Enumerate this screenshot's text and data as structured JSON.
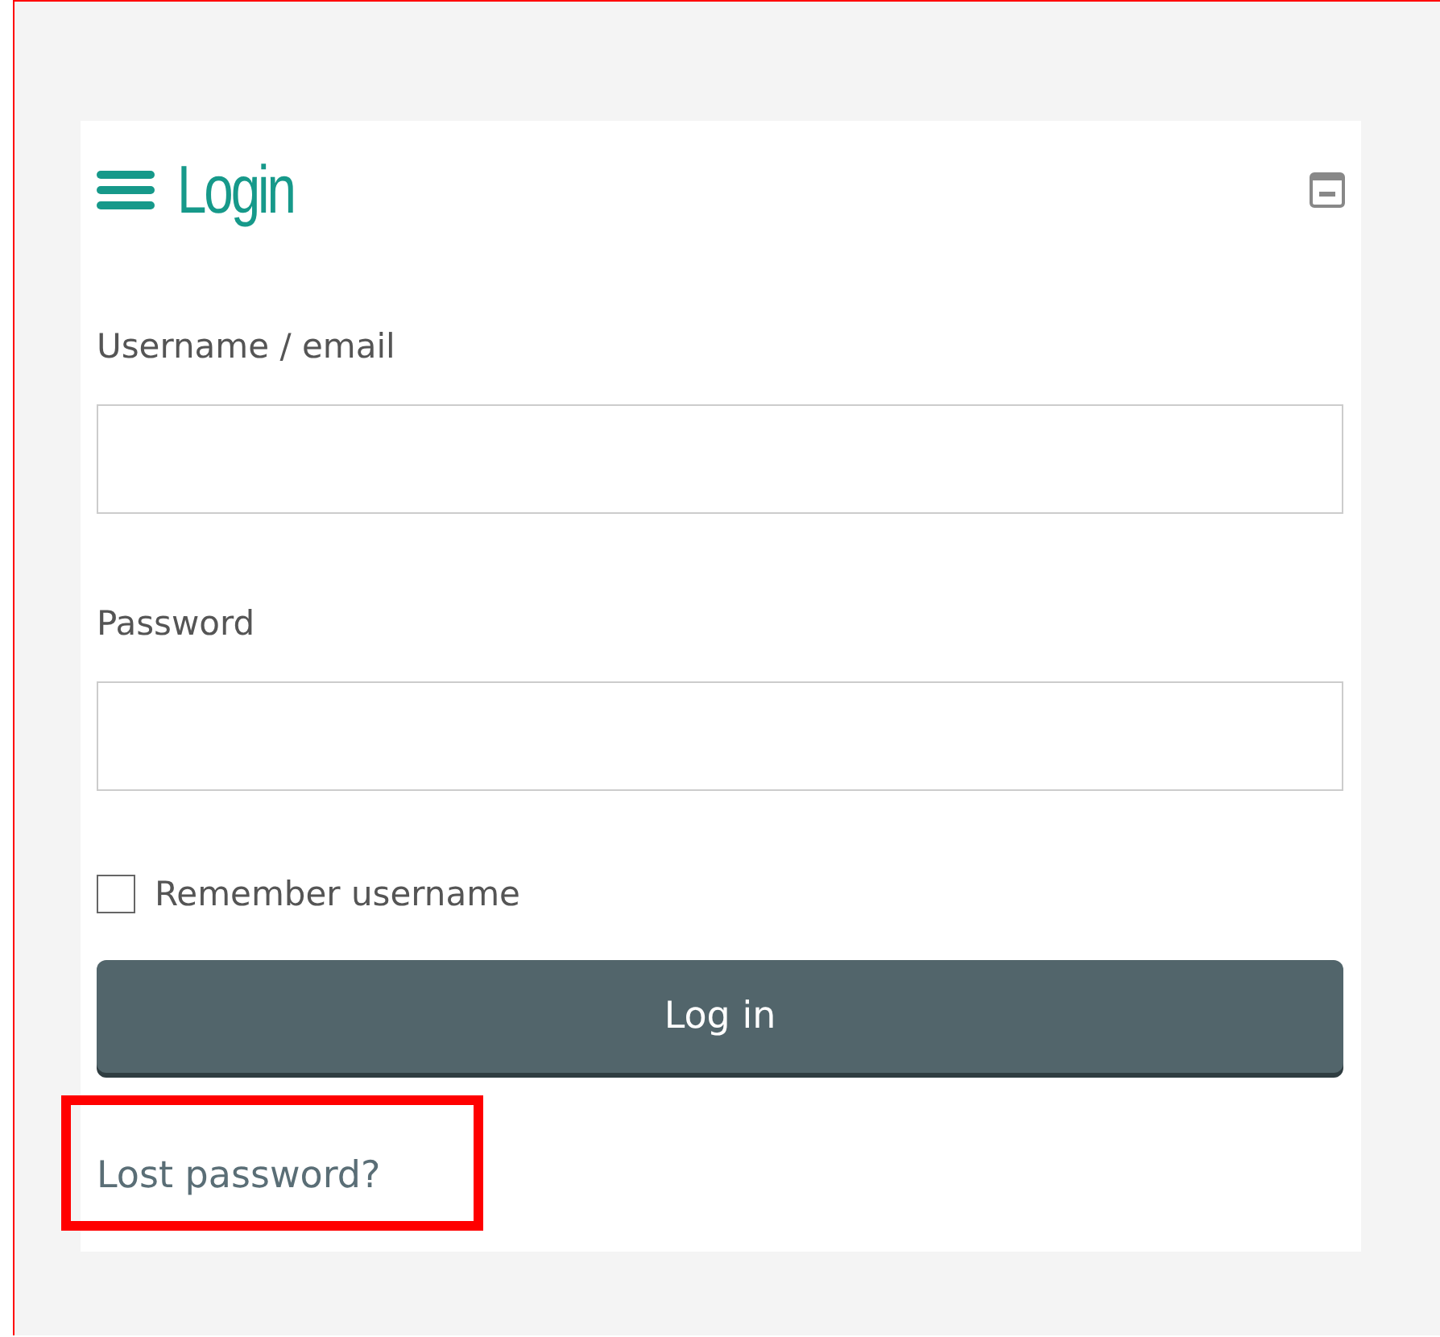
{
  "block": {
    "title": "Login"
  },
  "fields": [
    {
      "label": "Username / email"
    },
    {
      "label": "Password"
    }
  ],
  "remember": {
    "label": "Remember username",
    "checked": false
  },
  "submit": {
    "label": "Log in"
  },
  "lost_password": {
    "label": "Lost password?",
    "highlighted": true
  }
}
